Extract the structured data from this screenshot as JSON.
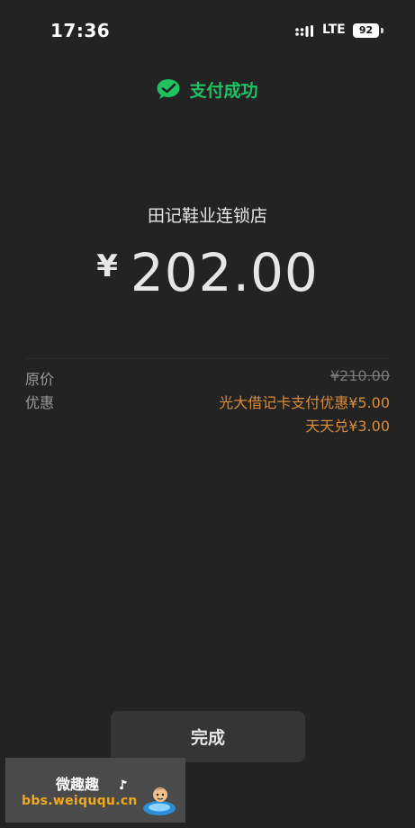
{
  "status_bar": {
    "time": "17:36",
    "network": "LTE",
    "battery": "92"
  },
  "header": {
    "title": "支付成功",
    "icon": "wechat-pay-icon",
    "accent_color": "#1fc161"
  },
  "payment": {
    "merchant": "田记鞋业连锁店",
    "currency_symbol": "¥",
    "amount": "202.00"
  },
  "details": {
    "original_price_label": "原价",
    "original_price_value": "¥210.00",
    "discount_label": "优惠",
    "discounts": [
      "光大借记卡支付优惠¥5.00",
      "天天兑¥3.00"
    ],
    "discount_color": "#d98c3a"
  },
  "actions": {
    "done_label": "完成"
  },
  "watermark": {
    "title": "微趣趣",
    "url": "bbs.weiququ.cn"
  }
}
